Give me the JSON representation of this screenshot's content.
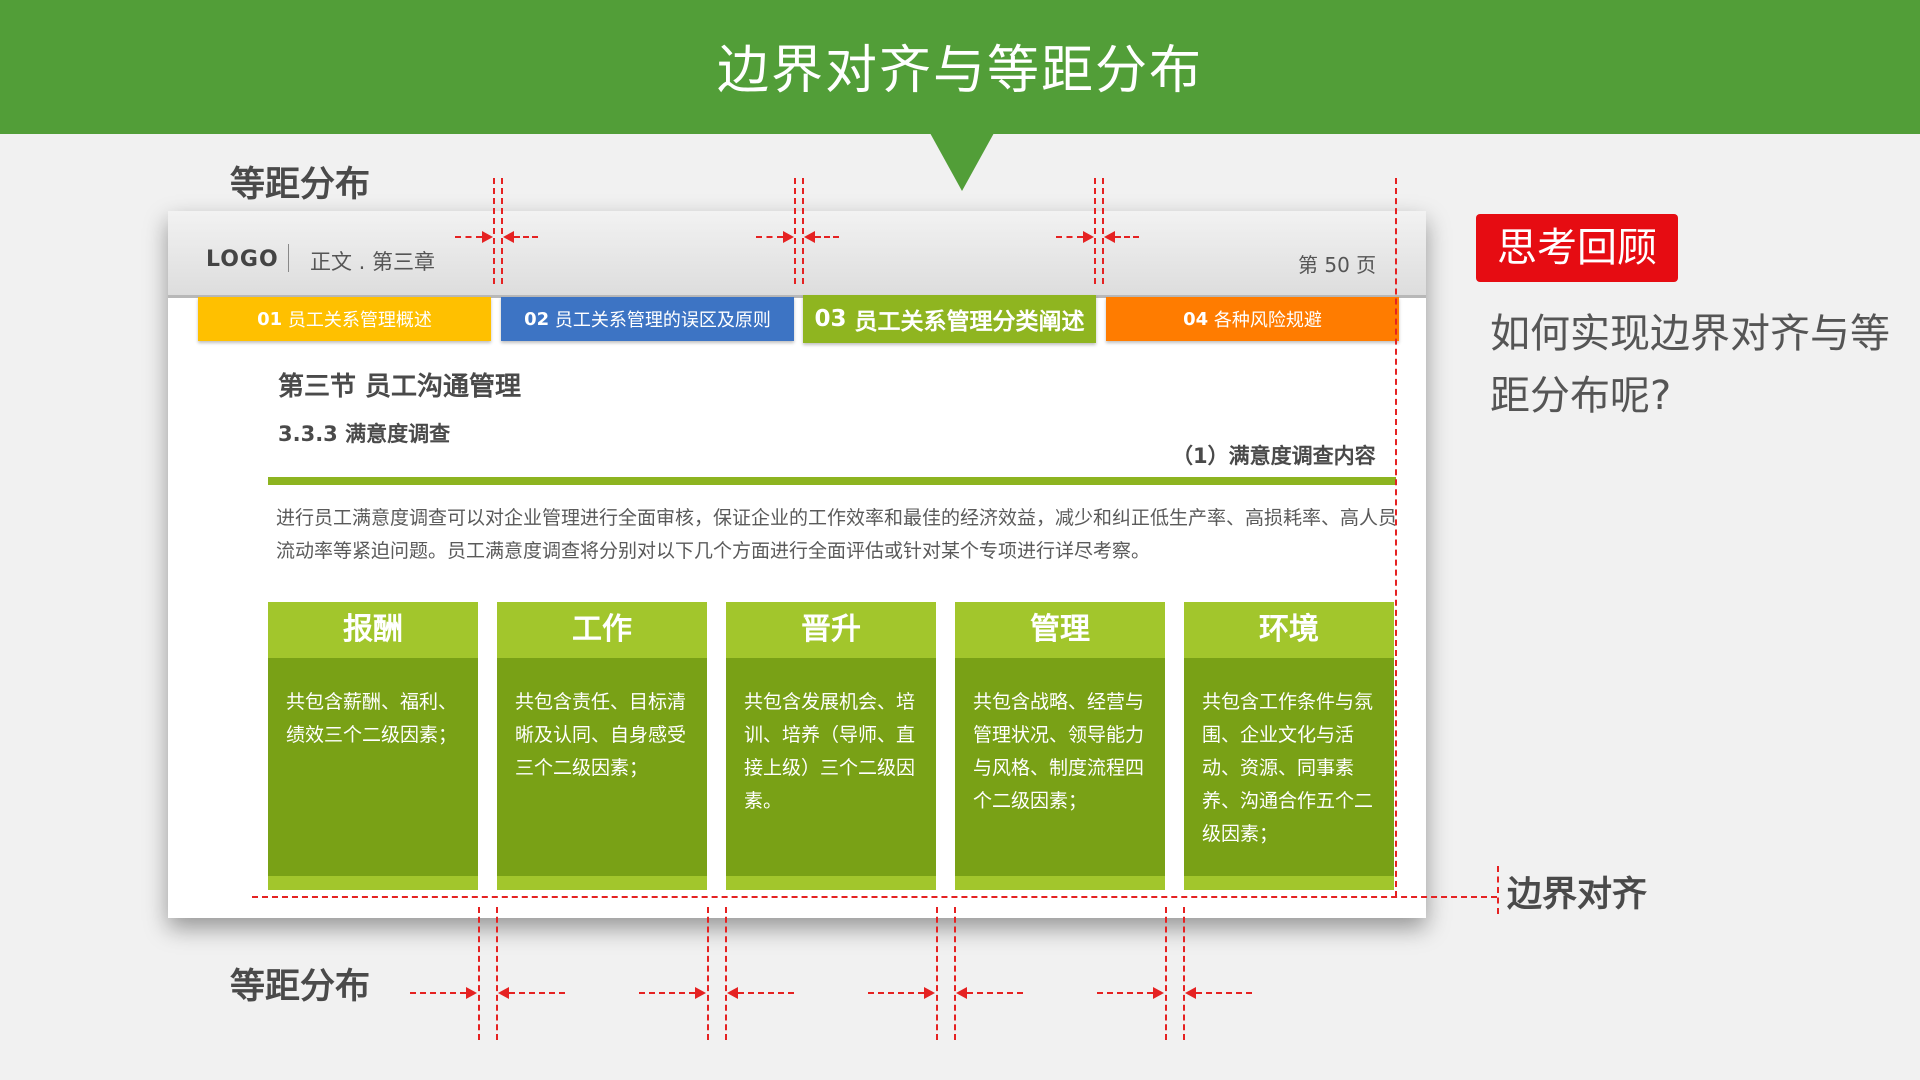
{
  "header": {
    "title": "边界对齐与等距分布",
    "color": "#529e38"
  },
  "labels": {
    "top_distribution": "等距分布",
    "bottom_distribution": "等距分布",
    "boundary_alignment": "边界对齐"
  },
  "slide": {
    "logo": "LOGO",
    "breadcrumb": "正文 . 第三章",
    "page_number": "第 50 页",
    "tabs": [
      {
        "num": "01",
        "label": "员工关系管理概述",
        "color": "#ffc000"
      },
      {
        "num": "02",
        "label": "员工关系管理的误区及原则",
        "color": "#3d74c4"
      },
      {
        "num": "03",
        "label": "员工关系管理分类阐述",
        "color": "#8fb520"
      },
      {
        "num": "04",
        "label": "各种风险规避",
        "color": "#ff7c00"
      }
    ],
    "section_title": "第三节  员工沟通管理",
    "subsection_title": "3.3.3 满意度调查",
    "right_title": "（1）满意度调查内容",
    "paragraph": "进行员工满意度调查可以对企业管理进行全面审核，保证企业的工作效率和最佳的经济效益，减少和纠正低生产率、高损耗率、高人员流动率等紧迫问题。员工满意度调查将分别对以下几个方面进行全面评估或针对某个专项进行详尽考察。",
    "cards": [
      {
        "title": "报酬",
        "text": "共包含薪酬、福利、绩效三个二级因素；"
      },
      {
        "title": "工作",
        "text": "共包含责任、目标清晰及认同、自身感受三个二级因素；"
      },
      {
        "title": "晋升",
        "text": "共包含发展机会、培训、培养（导师、直接上级）三个二级因素。"
      },
      {
        "title": "管理",
        "text": "共包含战略、经营与管理状况、领导能力与风格、制度流程四个二级因素；"
      },
      {
        "title": "环境",
        "text": "共包含工作条件与氛围、企业文化与活动、资源、同事素养、沟通合作五个二级因素；"
      }
    ]
  },
  "sidebar": {
    "badge": "思考回顾",
    "question": "如何实现边界对齐与等距分布呢?",
    "badge_color": "#e60c12"
  }
}
